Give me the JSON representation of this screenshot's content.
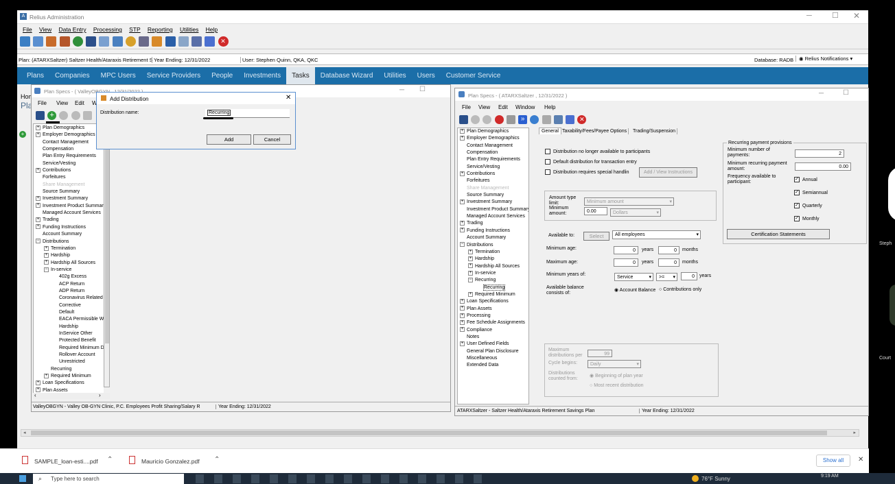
{
  "app_title": "Relius Administration",
  "menu": [
    "File",
    "View",
    "Data Entry",
    "Processing",
    "STP",
    "Reporting",
    "Utilities",
    "Help"
  ],
  "plan_info": "Plan: (ATARXSaltzer) Saltzer Health/Ataraxis Retirement S",
  "year_ending": "Year Ending: 12/31/2022",
  "user_info": "User: Stephen Quinn, QKA, QKC",
  "database": "Database: RADB",
  "notifications": "Relius Notifications",
  "nav_tabs": [
    "Plans",
    "Companies",
    "MPC Users",
    "Service Providers",
    "People",
    "Investments",
    "Tasks",
    "Database Wizard",
    "Utilities",
    "Users",
    "Customer Service"
  ],
  "home_crumb": "Hom",
  "plan_crumb": "Pla",
  "left_window": {
    "title": "Plan Specs - ( ValleyOBGYN , 12/31/2022 )",
    "menu": [
      "File",
      "View",
      "Edit",
      "W"
    ],
    "tree": [
      {
        "label": "Plan Demographics",
        "level": 0,
        "exp": "+"
      },
      {
        "label": "Employer Demographics",
        "level": 0,
        "exp": "+"
      },
      {
        "label": "Contact Management",
        "level": 0,
        "exp": ""
      },
      {
        "label": "Compensation",
        "level": 0,
        "exp": ""
      },
      {
        "label": "Plan Entry Requirements",
        "level": 0,
        "exp": ""
      },
      {
        "label": "Service/Vesting",
        "level": 0,
        "exp": ""
      },
      {
        "label": "Contributions",
        "level": 0,
        "exp": "+"
      },
      {
        "label": "Forfeitures",
        "level": 0,
        "exp": ""
      },
      {
        "label": "Share Management",
        "level": 0,
        "exp": "",
        "dim": true
      },
      {
        "label": "Source Summary",
        "level": 0,
        "exp": ""
      },
      {
        "label": "Investment Summary",
        "level": 0,
        "exp": "+"
      },
      {
        "label": "Investment Product Summary",
        "level": 0,
        "exp": "+"
      },
      {
        "label": "Managed Account Services",
        "level": 0,
        "exp": ""
      },
      {
        "label": "Trading",
        "level": 0,
        "exp": "+"
      },
      {
        "label": "Funding Instructions",
        "level": 0,
        "exp": "+"
      },
      {
        "label": "Account Summary",
        "level": 0,
        "exp": ""
      },
      {
        "label": "Distributions",
        "level": 0,
        "exp": "-"
      },
      {
        "label": "Termination",
        "level": 1,
        "exp": "+"
      },
      {
        "label": "Hardship",
        "level": 1,
        "exp": "+"
      },
      {
        "label": "Hardship All Sources",
        "level": 1,
        "exp": "+"
      },
      {
        "label": "In-service",
        "level": 1,
        "exp": "-"
      },
      {
        "label": "402g Excess",
        "level": 2,
        "exp": ""
      },
      {
        "label": "ACP Return",
        "level": 2,
        "exp": ""
      },
      {
        "label": "ADP Return",
        "level": 2,
        "exp": ""
      },
      {
        "label": "Coronavirus Related",
        "level": 2,
        "exp": ""
      },
      {
        "label": "Corrective",
        "level": 2,
        "exp": ""
      },
      {
        "label": "Default",
        "level": 2,
        "exp": ""
      },
      {
        "label": "EACA Permissible Wi",
        "level": 2,
        "exp": ""
      },
      {
        "label": "Hardship",
        "level": 2,
        "exp": ""
      },
      {
        "label": "InService Other",
        "level": 2,
        "exp": ""
      },
      {
        "label": "Protected Benefit",
        "level": 2,
        "exp": ""
      },
      {
        "label": "Required Minimum Di",
        "level": 2,
        "exp": ""
      },
      {
        "label": "Rollover Account",
        "level": 2,
        "exp": ""
      },
      {
        "label": "Unrestricted",
        "level": 2,
        "exp": ""
      },
      {
        "label": "Recurring",
        "level": 1,
        "exp": ""
      },
      {
        "label": "Required Minimum",
        "level": 1,
        "exp": "+"
      },
      {
        "label": "Loan Specifications",
        "level": 0,
        "exp": "+"
      },
      {
        "label": "Plan Assets",
        "level": 0,
        "exp": "+"
      }
    ],
    "status_plan": "ValleyOBGYN - Valley OB-GYN Clinic, P.C. Employees Profit Sharing/Salary R",
    "status_year": "Year Ending: 12/31/2022"
  },
  "dialog": {
    "title": "Add Distribution",
    "field_label": "Distribution name:",
    "field_value": "Recurring",
    "add_label": "Add",
    "cancel_label": "Cancel"
  },
  "right_window": {
    "title": "Plan Specs - ( ATARXSaltzer , 12/31/2022 )",
    "menu": [
      "File",
      "View",
      "Edit",
      "Window",
      "Help"
    ],
    "tabs": [
      "General",
      "Taxability/Fees/Payee Options",
      "Trading/Suspension"
    ],
    "tree": [
      {
        "label": "Plan Demographics",
        "level": 0,
        "exp": "+"
      },
      {
        "label": "Employer Demographics",
        "level": 0,
        "exp": "+"
      },
      {
        "label": "Contact Management",
        "level": 0,
        "exp": ""
      },
      {
        "label": "Compensation",
        "level": 0,
        "exp": ""
      },
      {
        "label": "Plan Entry Requirements",
        "level": 0,
        "exp": ""
      },
      {
        "label": "Service/Vesting",
        "level": 0,
        "exp": ""
      },
      {
        "label": "Contributions",
        "level": 0,
        "exp": "+"
      },
      {
        "label": "Forfeitures",
        "level": 0,
        "exp": ""
      },
      {
        "label": "Share Management",
        "level": 0,
        "exp": "",
        "dim": true
      },
      {
        "label": "Source Summary",
        "level": 0,
        "exp": ""
      },
      {
        "label": "Investment Summary",
        "level": 0,
        "exp": "+"
      },
      {
        "label": "Investment Product Summary",
        "level": 0,
        "exp": ""
      },
      {
        "label": "Managed Account Services",
        "level": 0,
        "exp": ""
      },
      {
        "label": "Trading",
        "level": 0,
        "exp": "+"
      },
      {
        "label": "Funding Instructions",
        "level": 0,
        "exp": "+"
      },
      {
        "label": "Account Summary",
        "level": 0,
        "exp": ""
      },
      {
        "label": "Distributions",
        "level": 0,
        "exp": "-"
      },
      {
        "label": "Termination",
        "level": 1,
        "exp": "+"
      },
      {
        "label": "Hardship",
        "level": 1,
        "exp": "+"
      },
      {
        "label": "Hardship All Sources",
        "level": 1,
        "exp": "+"
      },
      {
        "label": "In-service",
        "level": 1,
        "exp": "+"
      },
      {
        "label": "Recurring",
        "level": 1,
        "exp": "-"
      },
      {
        "label": "Recurring",
        "level": 2,
        "exp": "",
        "selected": true
      },
      {
        "label": "Required Minimum",
        "level": 1,
        "exp": "+"
      },
      {
        "label": "Loan Specifications",
        "level": 0,
        "exp": "+"
      },
      {
        "label": "Plan Assets",
        "level": 0,
        "exp": "+"
      },
      {
        "label": "Processing",
        "level": 0,
        "exp": "+"
      },
      {
        "label": "Fee Schedule Assignments",
        "level": 0,
        "exp": "+"
      },
      {
        "label": "Compliance",
        "level": 0,
        "exp": "+"
      },
      {
        "label": "Notes",
        "level": 0,
        "exp": ""
      },
      {
        "label": "User Defined Fields",
        "level": 0,
        "exp": "+"
      },
      {
        "label": "General Plan Disclosure",
        "level": 0,
        "exp": ""
      },
      {
        "label": "Miscellaneous",
        "level": 0,
        "exp": ""
      },
      {
        "label": "Extended Data",
        "level": 0,
        "exp": ""
      }
    ],
    "general": {
      "cb1": "Distribution no longer available to participants",
      "cb2": "Default distribution for transaction entry",
      "cb3": "Distribution requires special handlin",
      "view_instructions": "Add / View Instructions",
      "amount_type_label": "Amount type limit:",
      "amount_type_value": "Minimum amount",
      "minimum_amount_label": "Minimum amount:",
      "minimum_amount_value": "0.00",
      "minimum_amount_unit": "Dollars",
      "available_to_label": "Available to:",
      "select_label": "Select",
      "available_to_value": "All employees",
      "min_age_label": "Minimum age:",
      "min_age_years": "0",
      "min_age_months": "0",
      "max_age_label": "Maximum age:",
      "max_age_years": "0",
      "max_age_months": "0",
      "years_word": "years",
      "months_word": "months",
      "min_years_label": "Minimum years of:",
      "min_years_type": "Service",
      "min_years_op": ">=",
      "min_years_value": "0",
      "balance_label": "Available balance consists of:",
      "balance_opt1": "Account Balance",
      "balance_opt2": "Contributions only",
      "max_dist_label": "Maximum distributions per",
      "max_dist_value": "99",
      "cycle_label": "Cycle begins:",
      "cycle_value": "Daily",
      "counted_label": "Distributions counted from:",
      "counted_opt1": "Beginning of plan year",
      "counted_opt2": "Most recent distribution"
    },
    "recurring": {
      "title": "Recurring payment provisions",
      "min_payments_label": "Minimum number of payments:",
      "min_payments_value": "2",
      "min_amount_label": "Minimum recurring payment amount:",
      "min_amount_value": "0.00",
      "freq_label": "Frequency available to participant:",
      "freq": [
        "Annual",
        "Semiannual",
        "Quarterly",
        "Monthly"
      ],
      "cert_button": "Certification Statements"
    },
    "status_plan": "ATARXSaltzer - Saltzer Health/Ataraxis Retirement Savings Plan",
    "status_year": "Year Ending: 12/31/2022"
  },
  "downloads": [
    "SAMPLE_loan-esti....pdf",
    "Mauricio Gonzalez.pdf"
  ],
  "show_all": "Show all",
  "side_names": [
    "Steph",
    "Court"
  ],
  "taskbar": {
    "search": "Type here to search",
    "weather": "76°F Sunny",
    "time": "9:19 AM"
  }
}
